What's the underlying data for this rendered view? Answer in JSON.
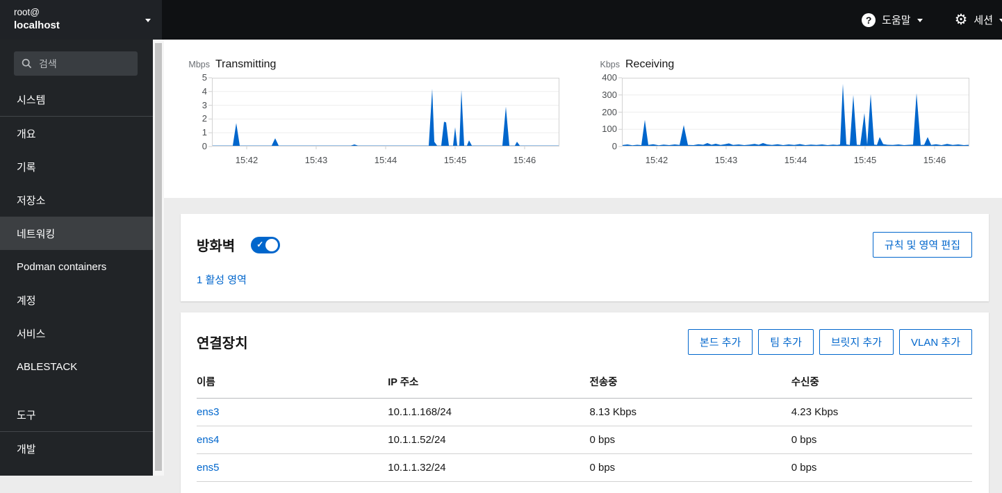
{
  "masthead": {
    "user": "root@",
    "host": "localhost",
    "help_label": "도움말",
    "session_label": "세션"
  },
  "sidebar": {
    "search_placeholder": "검색",
    "items": [
      {
        "id": "system",
        "label": "시스템",
        "divider_after": true
      },
      {
        "id": "overview",
        "label": "개요"
      },
      {
        "id": "logs",
        "label": "기록"
      },
      {
        "id": "storage",
        "label": "저장소"
      },
      {
        "id": "networking",
        "label": "네트워킹",
        "selected": true
      },
      {
        "id": "podman-containers",
        "label": "Podman containers"
      },
      {
        "id": "accounts",
        "label": "계정"
      },
      {
        "id": "services",
        "label": "서비스"
      },
      {
        "id": "ablestack",
        "label": "ABLESTACK"
      },
      {
        "id": "tools",
        "label": "도구",
        "spacer_before": true,
        "divider_after": true
      },
      {
        "id": "development",
        "label": "개발"
      }
    ]
  },
  "colors": {
    "accent": "#0066cc",
    "chart_fill": "#0066cc",
    "masthead_bg": "#0f1113",
    "sidebar_bg": "#212427",
    "sidebar_selected_bg": "#3c3f42",
    "content_bg": "#ececec"
  },
  "chart_data": [
    {
      "type": "area",
      "title": "Transmitting",
      "unit": "Mbps",
      "ylim": [
        0,
        5
      ],
      "yticks": [
        0,
        1,
        2,
        3,
        4,
        5
      ],
      "xticks": [
        "15:42",
        "15:43",
        "15:44",
        "15:45",
        "15:46"
      ],
      "xtick_minutes": [
        42,
        43,
        44,
        45,
        46
      ],
      "x_range_minutes": [
        41.5,
        46.5
      ],
      "grid": true,
      "legend": "none",
      "color": "#0066cc",
      "points": [
        [
          41.5,
          0.07
        ],
        [
          41.8,
          0.07
        ],
        [
          41.85,
          1.7
        ],
        [
          41.9,
          0.07
        ],
        [
          42.36,
          0.07
        ],
        [
          42.41,
          0.6
        ],
        [
          42.46,
          0.07
        ],
        [
          43.5,
          0.07
        ],
        [
          43.55,
          0.15
        ],
        [
          43.6,
          0.07
        ],
        [
          44.62,
          0.07
        ],
        [
          44.67,
          4.2
        ],
        [
          44.7,
          0.35
        ],
        [
          44.74,
          0.07
        ],
        [
          44.8,
          0.07
        ],
        [
          44.84,
          1.8
        ],
        [
          44.87,
          1.75
        ],
        [
          44.91,
          0.07
        ],
        [
          44.97,
          0.07
        ],
        [
          45.0,
          1.4
        ],
        [
          45.03,
          0.07
        ],
        [
          45.06,
          0.07
        ],
        [
          45.09,
          4.1
        ],
        [
          45.13,
          0.07
        ],
        [
          45.17,
          0.07
        ],
        [
          45.2,
          0.45
        ],
        [
          45.24,
          0.07
        ],
        [
          45.68,
          0.07
        ],
        [
          45.73,
          2.9
        ],
        [
          45.78,
          0.07
        ],
        [
          45.86,
          0.07
        ],
        [
          45.89,
          0.35
        ],
        [
          45.93,
          0.07
        ],
        [
          46.5,
          0.07
        ]
      ]
    },
    {
      "type": "area",
      "title": "Receiving",
      "unit": "Kbps",
      "ylim": [
        0,
        400
      ],
      "yticks": [
        0,
        100,
        200,
        300,
        400
      ],
      "xticks": [
        "15:42",
        "15:43",
        "15:44",
        "15:45",
        "15:46"
      ],
      "xtick_minutes": [
        42,
        43,
        44,
        45,
        46
      ],
      "x_range_minutes": [
        41.5,
        46.5
      ],
      "grid": true,
      "legend": "none",
      "color": "#0066cc",
      "points": [
        [
          41.5,
          8
        ],
        [
          41.58,
          12
        ],
        [
          41.65,
          7
        ],
        [
          41.72,
          10
        ],
        [
          41.78,
          8
        ],
        [
          41.83,
          155
        ],
        [
          41.88,
          9
        ],
        [
          41.95,
          13
        ],
        [
          42.03,
          7
        ],
        [
          42.1,
          11
        ],
        [
          42.18,
          8
        ],
        [
          42.26,
          12
        ],
        [
          42.33,
          9
        ],
        [
          42.39,
          125
        ],
        [
          42.45,
          9
        ],
        [
          42.53,
          8
        ],
        [
          42.6,
          13
        ],
        [
          42.67,
          10
        ],
        [
          42.73,
          20
        ],
        [
          42.79,
          10
        ],
        [
          42.85,
          16
        ],
        [
          42.92,
          9
        ],
        [
          42.98,
          13
        ],
        [
          43.04,
          18
        ],
        [
          43.1,
          9
        ],
        [
          43.18,
          12
        ],
        [
          43.26,
          8
        ],
        [
          43.34,
          11
        ],
        [
          43.41,
          15
        ],
        [
          43.47,
          10
        ],
        [
          43.53,
          20
        ],
        [
          43.59,
          12
        ],
        [
          43.66,
          9
        ],
        [
          43.74,
          13
        ],
        [
          43.82,
          8
        ],
        [
          43.9,
          12
        ],
        [
          43.98,
          9
        ],
        [
          44.06,
          14
        ],
        [
          44.14,
          8
        ],
        [
          44.22,
          11
        ],
        [
          44.3,
          9
        ],
        [
          44.38,
          12
        ],
        [
          44.46,
          8
        ],
        [
          44.54,
          11
        ],
        [
          44.6,
          9
        ],
        [
          44.64,
          12
        ],
        [
          44.68,
          365
        ],
        [
          44.73,
          12
        ],
        [
          44.78,
          9
        ],
        [
          44.83,
          300
        ],
        [
          44.88,
          10
        ],
        [
          44.93,
          9
        ],
        [
          44.99,
          195
        ],
        [
          45.03,
          10
        ],
        [
          45.08,
          305
        ],
        [
          45.13,
          11
        ],
        [
          45.17,
          9
        ],
        [
          45.21,
          55
        ],
        [
          45.26,
          14
        ],
        [
          45.32,
          10
        ],
        [
          45.4,
          9
        ],
        [
          45.48,
          12
        ],
        [
          45.56,
          8
        ],
        [
          45.63,
          10
        ],
        [
          45.69,
          11
        ],
        [
          45.74,
          310
        ],
        [
          45.8,
          9
        ],
        [
          45.85,
          10
        ],
        [
          45.9,
          55
        ],
        [
          45.95,
          9
        ],
        [
          46.02,
          13
        ],
        [
          46.1,
          8
        ],
        [
          46.18,
          15
        ],
        [
          46.26,
          9
        ],
        [
          46.34,
          12
        ],
        [
          46.42,
          8
        ],
        [
          46.5,
          10
        ]
      ]
    }
  ],
  "firewall": {
    "title": "방화벽",
    "toggle_on": true,
    "zones_link": "1 활성 영역",
    "edit_button": "규칙 및 영역 편집"
  },
  "interfaces": {
    "title": "연결장치",
    "buttons": [
      {
        "id": "add-bond",
        "label": "본드 추가"
      },
      {
        "id": "add-team",
        "label": "팀 추가"
      },
      {
        "id": "add-bridge",
        "label": "브릿지 추가"
      },
      {
        "id": "add-vlan",
        "label": "VLAN 추가"
      }
    ],
    "table": {
      "headers": [
        "이름",
        "IP 주소",
        "전송중",
        "수신중"
      ],
      "rows": [
        {
          "name": "ens3",
          "ip": "10.1.1.168/24",
          "tx": "8.13 Kbps",
          "rx": "4.23 Kbps"
        },
        {
          "name": "ens4",
          "ip": "10.1.1.52/24",
          "tx": "0 bps",
          "rx": "0 bps"
        },
        {
          "name": "ens5",
          "ip": "10.1.1.32/24",
          "tx": "0 bps",
          "rx": "0 bps"
        }
      ]
    }
  }
}
